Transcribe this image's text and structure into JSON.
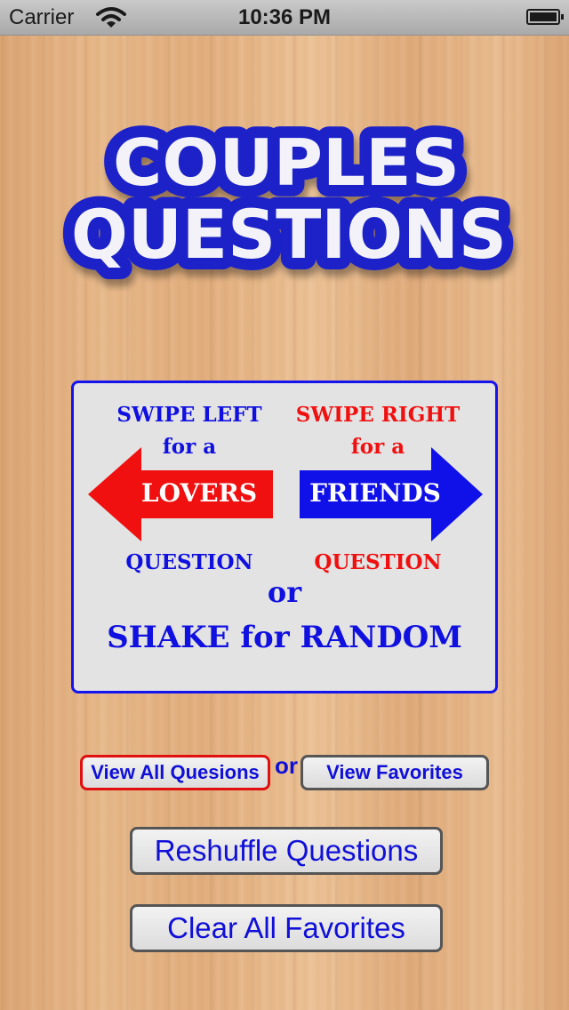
{
  "status_bar": {
    "carrier": "Carrier",
    "time": "10:36 PM",
    "wifi_icon": "wifi-icon",
    "battery_icon": "battery-icon",
    "battery_level": 1.0
  },
  "logo": {
    "line1": "COUPLES",
    "line2": "QUESTIONS"
  },
  "instructions": {
    "left_header": "SWIPE LEFT",
    "left_sub": "for a",
    "left_arrow_label": "LOVERS",
    "left_footer": "QUESTION",
    "right_header": "SWIPE RIGHT",
    "right_sub": "for a",
    "right_arrow_label": "FRIENDS",
    "right_footer": "QUESTION",
    "or_text": "or",
    "shake_text": "SHAKE for RANDOM"
  },
  "buttons": {
    "view_all": "View All Quesions",
    "or_separator": "or",
    "view_favorites": "View Favorites",
    "reshuffle": "Reshuffle Questions",
    "clear_favorites": "Clear All Favorites"
  },
  "colors": {
    "blue_accent": "#1010e0",
    "red_accent": "#f01010",
    "selected_border": "#e01010",
    "logo_blue": "#1a22c8"
  }
}
